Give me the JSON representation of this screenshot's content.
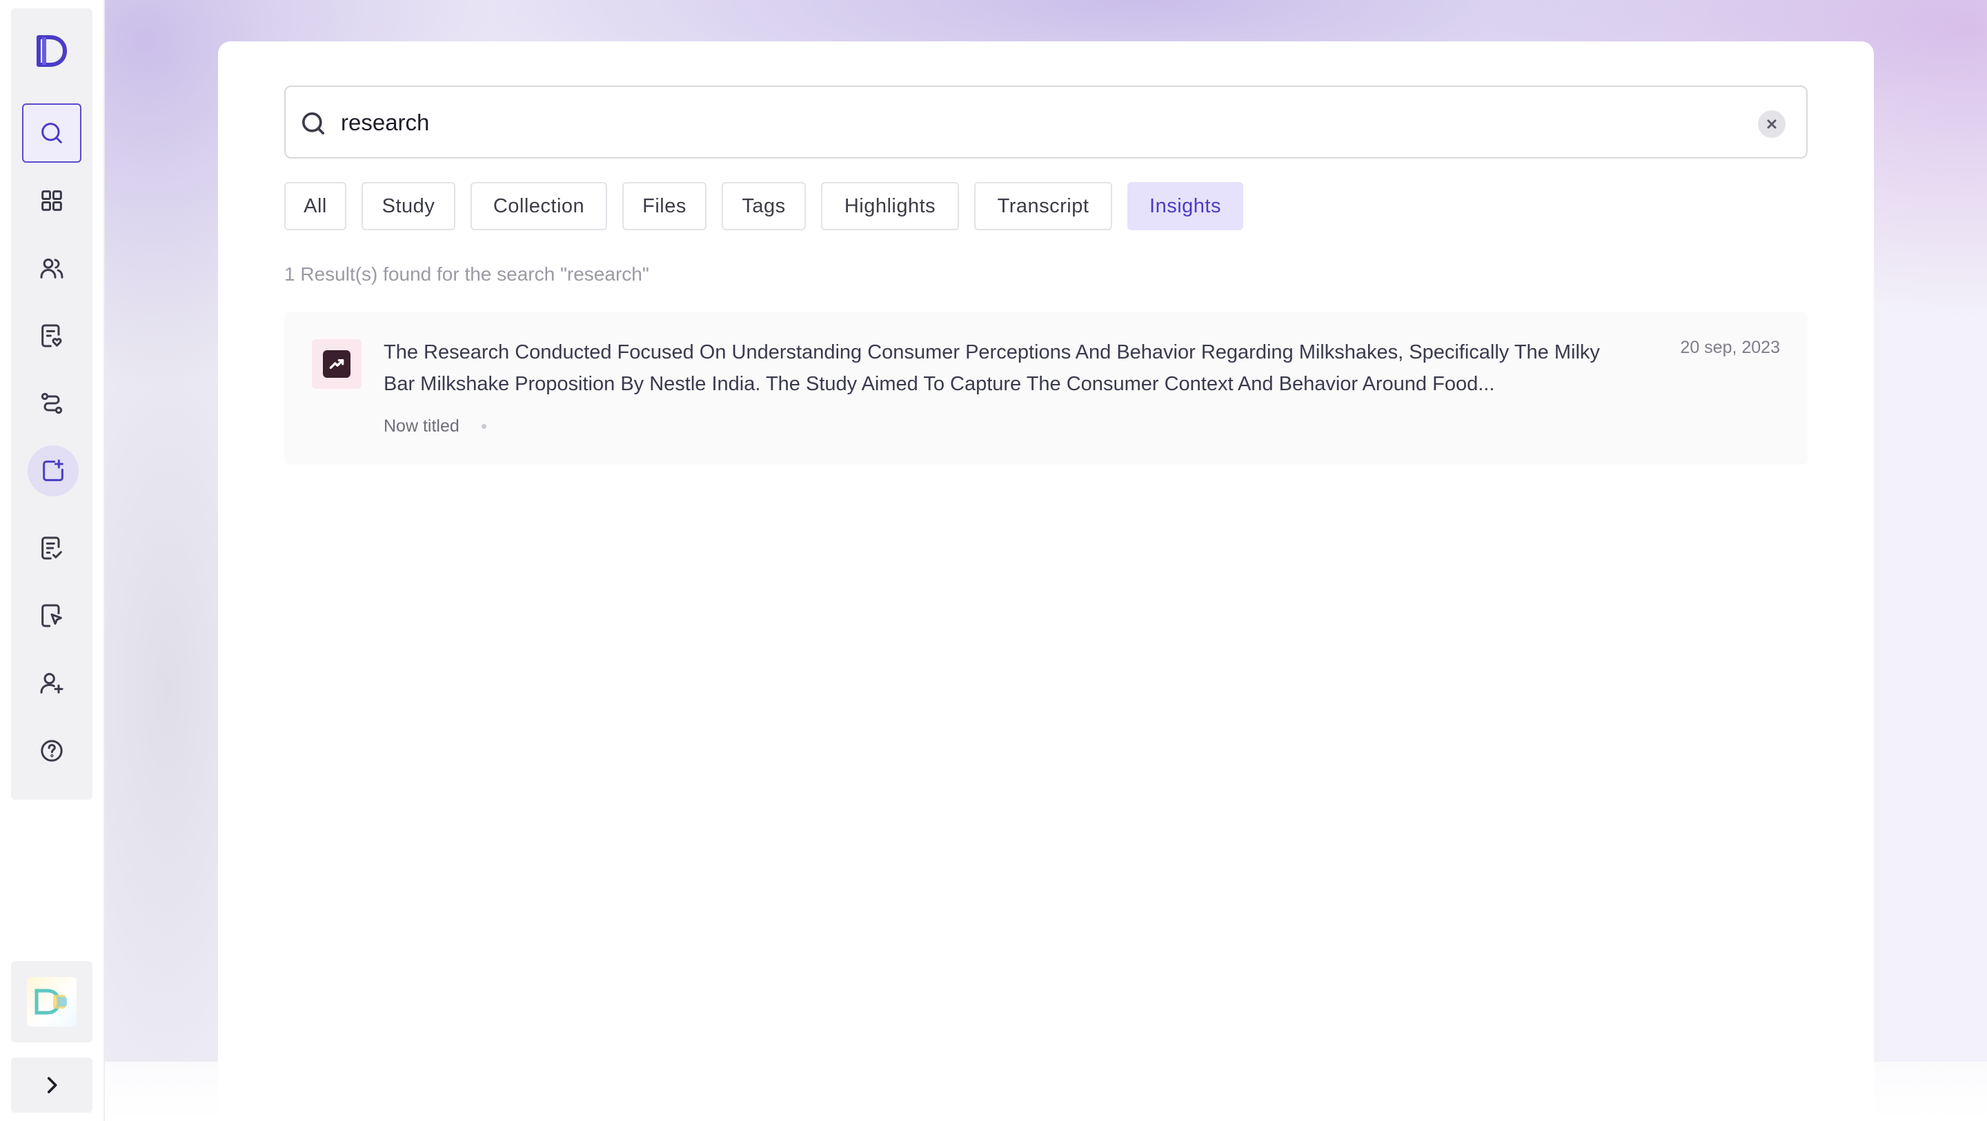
{
  "app": {
    "brand": "D"
  },
  "sidebar": {
    "items": [
      {
        "icon": "search-icon",
        "active": true
      },
      {
        "icon": "grid-icon"
      },
      {
        "icon": "users-icon"
      },
      {
        "icon": "checklist-heart-icon"
      },
      {
        "icon": "route-icon"
      },
      {
        "icon": "calendar-plus-icon",
        "highlight": true
      },
      {
        "icon": "document-check-icon"
      },
      {
        "icon": "file-pointer-icon"
      },
      {
        "icon": "user-plus-icon"
      },
      {
        "icon": "help-icon"
      }
    ],
    "expand_icon": "chevron-right-icon"
  },
  "search": {
    "value": "research",
    "placeholder": "Search"
  },
  "filters": {
    "chips": [
      "All",
      "Study",
      "Collection",
      "Files",
      "Tags",
      "Highlights",
      "Transcript",
      "Insights"
    ],
    "active": "Insights"
  },
  "results": {
    "summary": "1 Result(s) found for the search \"research\"",
    "items": [
      {
        "icon": "insight-trend-icon",
        "text": "The Research Conducted Focused On Understanding Consumer Perceptions And Behavior Regarding Milkshakes, Specifically The Milky Bar Milkshake Proposition By Nestle India. The Study Aimed To Capture The Consumer Context And Behavior Around Food...",
        "date": "20 sep, 2023",
        "meta": "Now titled"
      }
    ]
  },
  "colors": {
    "accent": "#4a3cc6",
    "active_chip_bg": "#e6e2fb",
    "insight_icon_bg": "#3a1f2c"
  }
}
